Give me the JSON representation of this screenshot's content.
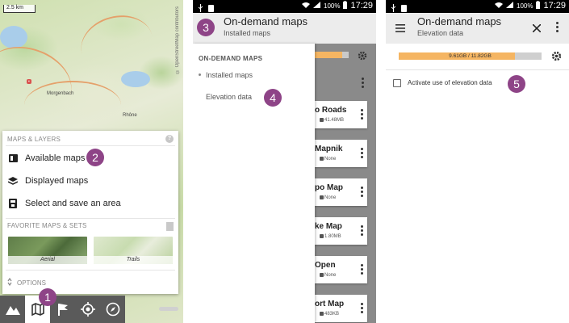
{
  "status_bar": {
    "battery": "100%",
    "time": "17:29"
  },
  "screen1": {
    "scale_text": "2.5 km",
    "watermark": "© OpenStreetMap contributors",
    "map_places": [
      "Morgenbach",
      "Rhône"
    ],
    "panel": {
      "section_maps": "MAPS & LAYERS",
      "items": [
        {
          "label": "Available maps",
          "icon": "map-book-icon"
        },
        {
          "label": "Displayed maps",
          "icon": "layers-icon"
        },
        {
          "label": "Select and save an area",
          "icon": "save-area-icon"
        }
      ],
      "section_favorites": "FAVORITE MAPS & SETS",
      "favorites": [
        {
          "label": "Aerial"
        },
        {
          "label": "Trails"
        }
      ],
      "options_label": "OPTIONS"
    },
    "bottom_bar": [
      "mountains-icon",
      "map-icon",
      "flag-icon",
      "crosshair-icon",
      "compass-icon"
    ],
    "callouts": [
      "1",
      "2"
    ]
  },
  "screen2": {
    "header_title": "On-demand maps",
    "header_subtitle": "Installed maps",
    "drawer": {
      "heading": "ON-DEMAND MAPS",
      "items": [
        "Installed maps",
        "Elevation data"
      ]
    },
    "cards": [
      {
        "title": "o Roads",
        "size": "41.48MB"
      },
      {
        "title": "Mapnik",
        "size": "None"
      },
      {
        "title": "po Map",
        "size": "None"
      },
      {
        "title": "ke Map",
        "size": "1.80MB"
      },
      {
        "title": "Open",
        "size": "None"
      },
      {
        "title": "ort Map",
        "size": "483KB"
      }
    ],
    "storage_fraction": 0.82,
    "callouts": [
      "3",
      "4"
    ]
  },
  "screen3": {
    "header_title": "On-demand maps",
    "header_subtitle": "Elevation data",
    "storage_text": "9.61GB / 11.82GB",
    "storage_fraction": 0.813,
    "checkbox_label": "Activate use of elevation data",
    "checkbox_checked": false,
    "callouts": [
      "5"
    ]
  },
  "colors": {
    "accent_callout": "#8e4487",
    "progress_fill": "#f5b562",
    "toolbar": "#5a5a5a"
  }
}
